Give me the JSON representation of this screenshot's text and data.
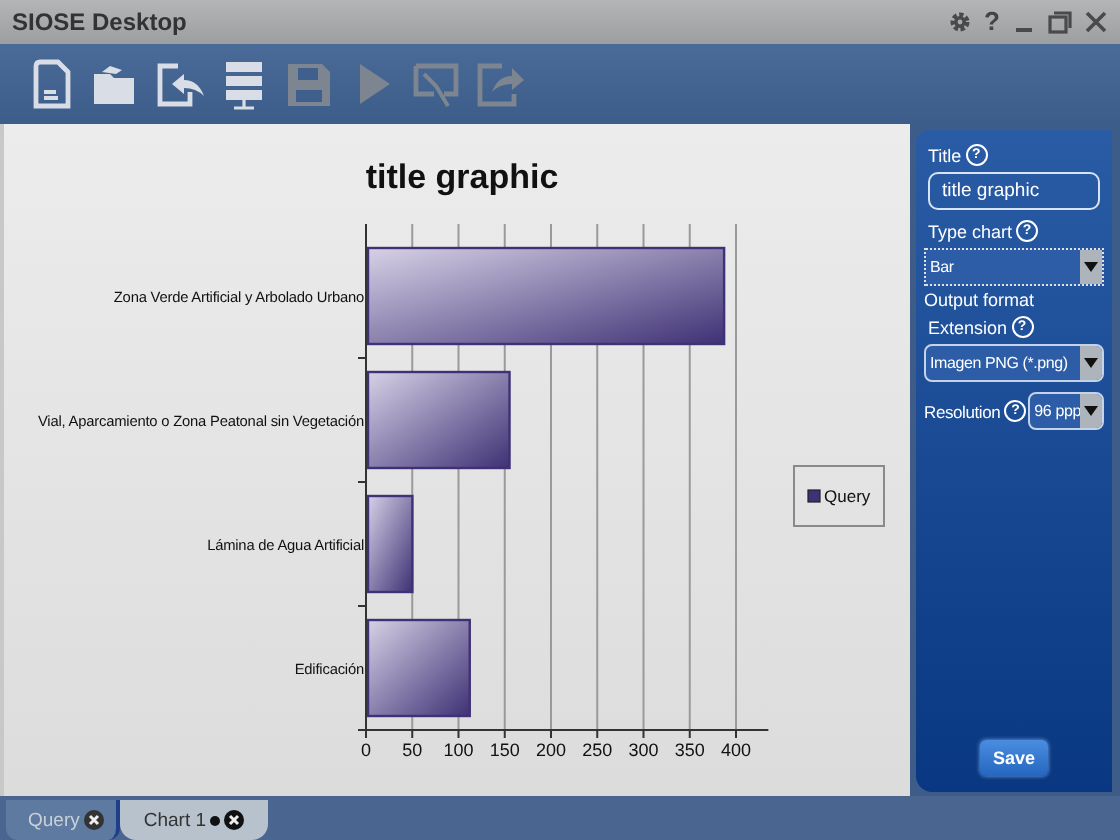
{
  "window": {
    "title": "SIOSE Desktop",
    "help": "?"
  },
  "toolbar": [
    {
      "kind": "new-document",
      "disabled": false
    },
    {
      "kind": "open-folder",
      "disabled": false
    },
    {
      "kind": "import",
      "disabled": false
    },
    {
      "kind": "server",
      "disabled": false
    },
    {
      "kind": "save",
      "disabled": true
    },
    {
      "kind": "run",
      "disabled": true
    },
    {
      "kind": "chart-edit",
      "disabled": true
    },
    {
      "kind": "export",
      "disabled": true
    }
  ],
  "chart": {
    "chart_data": {
      "type": "bar",
      "orientation": "horizontal",
      "title": "title graphic",
      "categories": [
        "Zona Verde Artificial y Arbolado Urbano",
        "Vial, Aparcamiento o Zona Peatonal sin Vegetación",
        "Lámina de Agua Artificial",
        "Edificación"
      ],
      "series": [
        {
          "name": "Query",
          "color": "#3f3175",
          "values": [
            385,
            153,
            48,
            110
          ]
        }
      ],
      "xlim": [
        0,
        435
      ],
      "grid": true,
      "xticks": [
        0,
        50,
        100,
        150,
        200,
        250,
        300,
        350,
        400
      ]
    }
  },
  "side_panel": {
    "fields": [
      {
        "kind": "text",
        "label": "Title",
        "help": "?",
        "value": "title graphic"
      },
      {
        "kind": "select",
        "label": "Type chart",
        "help": "?",
        "value": "Bar",
        "focused": true
      },
      {
        "kind": "heading",
        "label": "Output format"
      },
      {
        "kind": "select",
        "label": "Extension",
        "help": "?",
        "value": "Imagen PNG (*.png)",
        "focused": false
      },
      {
        "kind": "inline-select",
        "label": "Resolution",
        "help": "?",
        "value": "96 ppp",
        "focused": false
      }
    ],
    "save_button": "Save"
  },
  "tabs": [
    {
      "label": "Query",
      "selected": false,
      "modified": false
    },
    {
      "label": "Chart 1",
      "selected": true,
      "modified": true
    }
  ]
}
